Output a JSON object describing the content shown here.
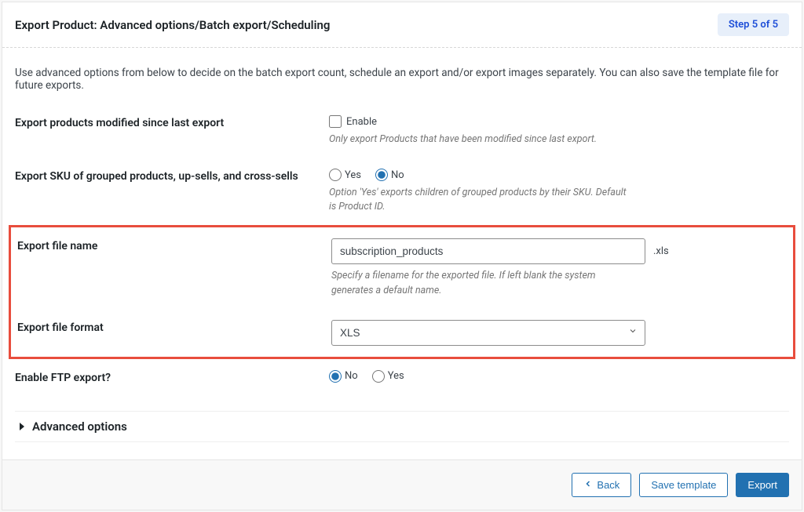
{
  "header": {
    "title": "Export Product: Advanced options/Batch export/Scheduling",
    "step_badge": "Step 5 of 5"
  },
  "intro": "Use advanced options from below to decide on the batch export count, schedule an export and/or export images separately. You can also save the template file for future exports.",
  "fields": {
    "modified_since": {
      "label": "Export products modified since last export",
      "checkbox_label": "Enable",
      "help": "Only export Products that have been modified since last export."
    },
    "sku_grouped": {
      "label": "Export SKU of grouped products, up-sells, and cross-sells",
      "yes_label": "Yes",
      "no_label": "No",
      "selected": "No",
      "help": "Option 'Yes' exports children of grouped products by their SKU. Default is Product ID."
    },
    "filename": {
      "label": "Export file name",
      "value": "subscription_products",
      "extension": ".xls",
      "help": "Specify a filename for the exported file. If left blank the system generates a default name."
    },
    "format": {
      "label": "Export file format",
      "value": "XLS"
    },
    "ftp": {
      "label": "Enable FTP export?",
      "no_label": "No",
      "yes_label": "Yes",
      "selected": "No"
    }
  },
  "advanced": {
    "label": "Advanced options"
  },
  "footer": {
    "back": "Back",
    "save_template": "Save template",
    "export": "Export"
  }
}
